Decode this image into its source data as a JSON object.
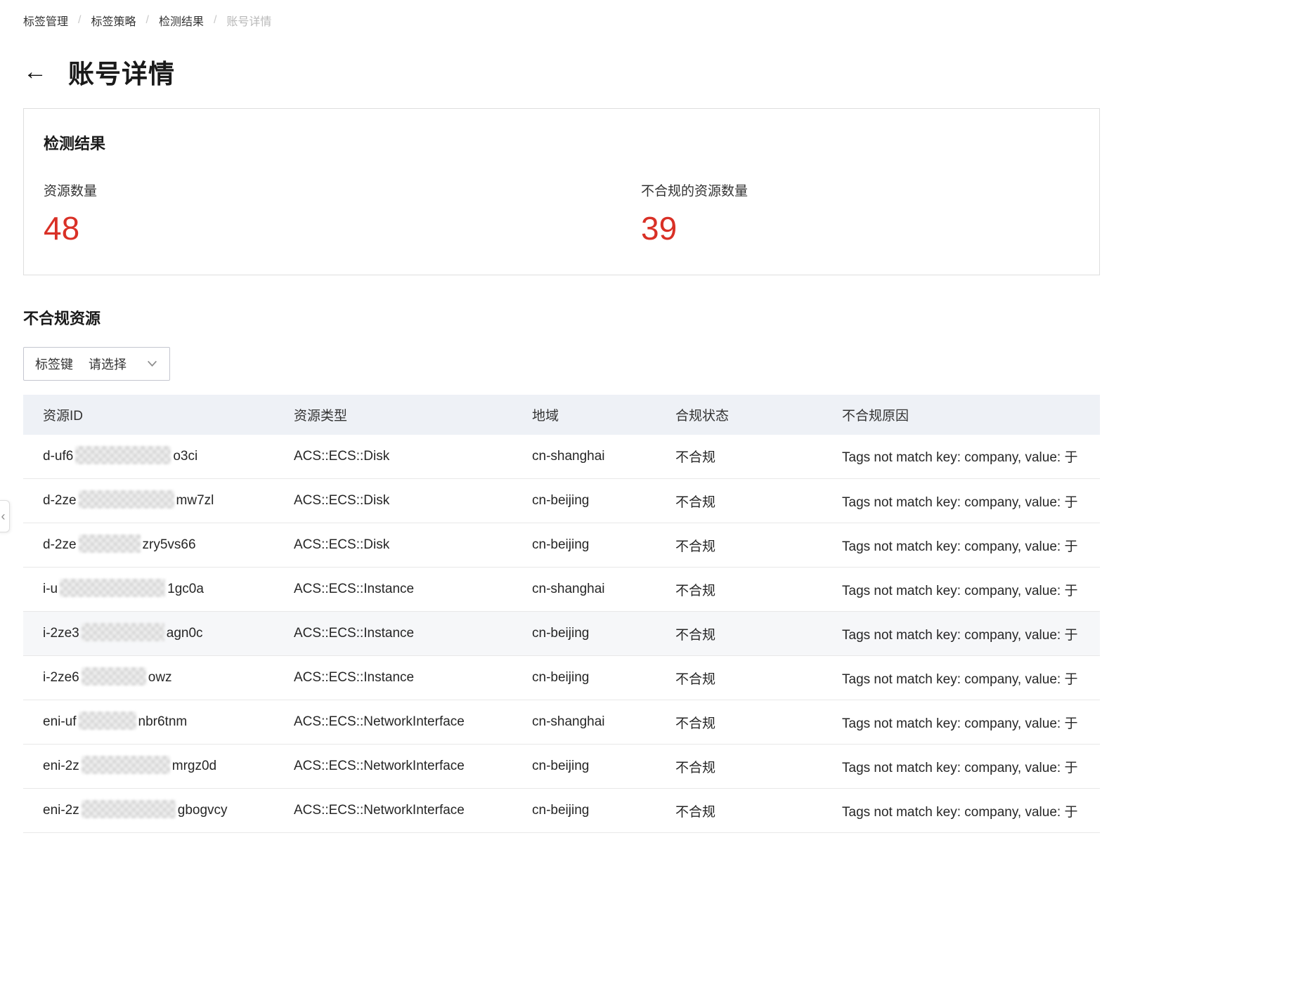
{
  "breadcrumb": {
    "items": [
      "标签管理",
      "标签策略",
      "检测结果"
    ],
    "separator": "/",
    "current": "账号详情"
  },
  "page": {
    "title": "账号详情",
    "back_icon": "←"
  },
  "summary_card": {
    "title": "检测结果",
    "stats": [
      {
        "label": "资源数量",
        "value": "48"
      },
      {
        "label": "不合规的资源数量",
        "value": "39"
      }
    ],
    "value_color": "#D93026"
  },
  "section": {
    "title": "不合规资源"
  },
  "filter": {
    "label": "标签键",
    "placeholder": "请选择"
  },
  "table": {
    "columns": [
      "资源ID",
      "资源类型",
      "地域",
      "合规状态",
      "不合规原因"
    ],
    "rows": [
      {
        "id_prefix": "d-uf6",
        "id_suffix": "o3ci",
        "type": "ACS::ECS::Disk",
        "region": "cn-shanghai",
        "status": "不合规",
        "reason": "Tags not match key: company, value: 于"
      },
      {
        "id_prefix": "d-2ze",
        "id_suffix": "mw7zl",
        "type": "ACS::ECS::Disk",
        "region": "cn-beijing",
        "status": "不合规",
        "reason": "Tags not match key: company, value: 于"
      },
      {
        "id_prefix": "d-2ze",
        "id_suffix": "zry5vs66",
        "type": "ACS::ECS::Disk",
        "region": "cn-beijing",
        "status": "不合规",
        "reason": "Tags not match key: company, value: 于"
      },
      {
        "id_prefix": "i-u",
        "id_suffix": "1gc0a",
        "type": "ACS::ECS::Instance",
        "region": "cn-shanghai",
        "status": "不合规",
        "reason": "Tags not match key: company, value: 于"
      },
      {
        "id_prefix": "i-2ze3",
        "id_suffix": "agn0c",
        "type": "ACS::ECS::Instance",
        "region": "cn-beijing",
        "status": "不合规",
        "reason": "Tags not match key: company, value: 于"
      },
      {
        "id_prefix": "i-2ze6",
        "id_suffix": "owz",
        "type": "ACS::ECS::Instance",
        "region": "cn-beijing",
        "status": "不合规",
        "reason": "Tags not match key: company, value: 于"
      },
      {
        "id_prefix": "eni-uf",
        "id_suffix": "nbr6tnm",
        "type": "ACS::ECS::NetworkInterface",
        "region": "cn-shanghai",
        "status": "不合规",
        "reason": "Tags not match key: company, value: 于"
      },
      {
        "id_prefix": "eni-2z",
        "id_suffix": "mrgz0d",
        "type": "ACS::ECS::NetworkInterface",
        "region": "cn-beijing",
        "status": "不合规",
        "reason": "Tags not match key: company, value: 于"
      },
      {
        "id_prefix": "eni-2z",
        "id_suffix": "gbogvcy",
        "type": "ACS::ECS::NetworkInterface",
        "region": "cn-beijing",
        "status": "不合规",
        "reason": "Tags not match key: company, value: 于"
      }
    ]
  },
  "side_handle": {
    "icon": "‹"
  }
}
